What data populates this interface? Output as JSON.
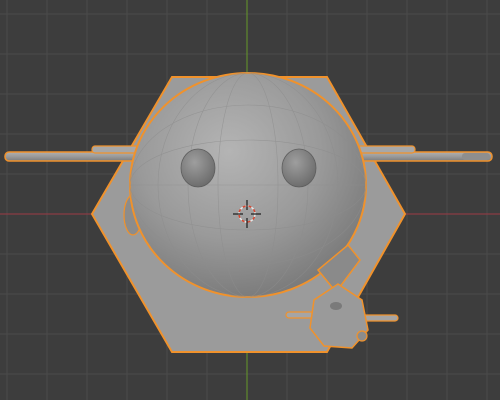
{
  "viewport": {
    "mode": "object-mode",
    "view": "front-orthographic"
  },
  "colors": {
    "background": "#3d3d3d",
    "grid_line": "#4a4a4a",
    "axis_x": "#8a3c44",
    "axis_z": "#5f8a2d",
    "selection_outline": "#f0922c",
    "mesh_light": "#a3a3a3",
    "mesh_mid": "#8f8f8f",
    "mesh_dark": "#6e6e6e"
  },
  "scene": {
    "objects": [
      {
        "name": "hexagon-base",
        "selected": true
      },
      {
        "name": "sphere-head",
        "selected": true
      },
      {
        "name": "side-rods",
        "selected": true
      },
      {
        "name": "small-robot",
        "selected": true
      }
    ],
    "cursor_3d": "3d-cursor-icon"
  }
}
